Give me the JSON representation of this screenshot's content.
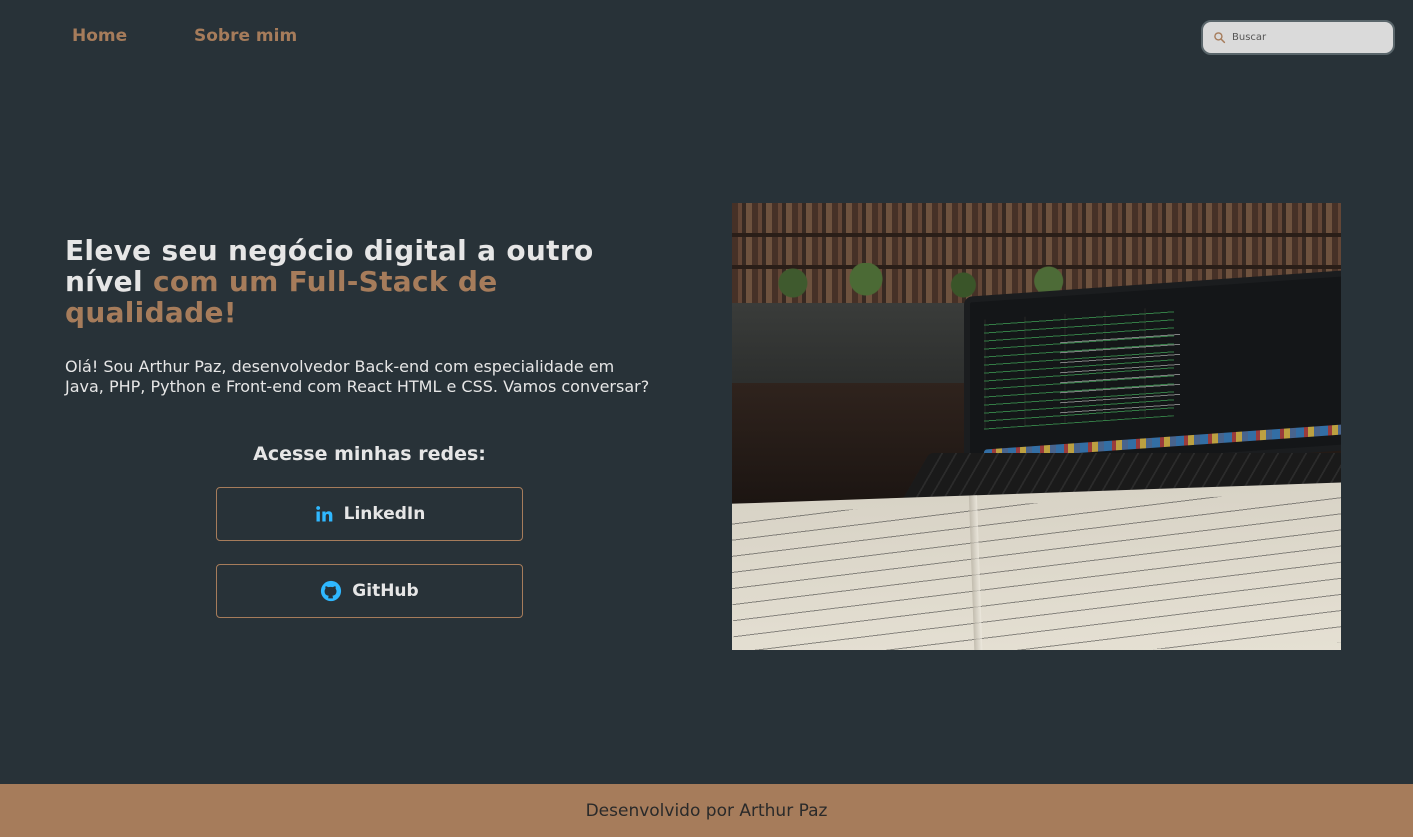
{
  "nav": {
    "links": [
      {
        "label": "Home"
      },
      {
        "label": "Sobre mim"
      }
    ],
    "search": {
      "placeholder": "Buscar",
      "value": ""
    }
  },
  "hero": {
    "title_part1": "Eleve seu negócio digital a outro nível",
    "title_part2": "com um Full-Stack de qualidade!",
    "description": "Olá! Sou Arthur Paz, desenvolvedor Back-end com especialidade em Java, PHP, Python e Front-end com React HTML e CSS. Vamos conversar?",
    "social_heading": "Acesse minhas redes:",
    "social": [
      {
        "label": "LinkedIn",
        "icon": "linkedin-icon"
      },
      {
        "label": "GitHub",
        "icon": "github-icon"
      }
    ],
    "image_alt": "laptop-and-notebook-photo"
  },
  "footer": {
    "text": "Desenvolvido por Arthur Paz"
  },
  "colors": {
    "background": "#283238",
    "accent": "#a67c5b",
    "text": "#e6e6e6",
    "icon_blue": "#2fb8ff"
  }
}
